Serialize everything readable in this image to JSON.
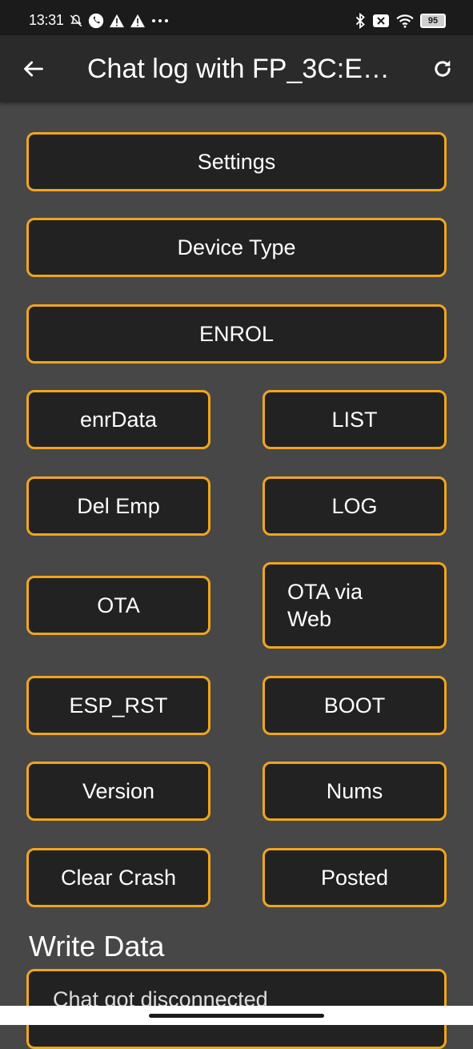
{
  "status_bar": {
    "time": "13:31",
    "battery": "95",
    "left_icons": [
      "mute-icon",
      "phone-icon",
      "warning-icon",
      "warning-icon",
      "more-icon"
    ],
    "right_icons": [
      "bluetooth-icon",
      "mute-box-icon",
      "wifi-icon",
      "battery-icon"
    ]
  },
  "app_bar": {
    "title": "Chat log with FP_3C:E…",
    "back_icon": "arrow-left-icon",
    "refresh_icon": "refresh-icon"
  },
  "buttons": {
    "settings": "Settings",
    "device_type": "Device Type",
    "enrol": "ENROL",
    "enr_data": "enrData",
    "list": "LIST",
    "del_emp": "Del Emp",
    "log": "LOG",
    "ota": "OTA",
    "ota_via_web_line1": "OTA via",
    "ota_via_web_line2": "Web",
    "esp_rst": "ESP_RST",
    "boot": "BOOT",
    "version": "Version",
    "nums": "Nums",
    "clear_crash": "Clear Crash",
    "posted": "Posted"
  },
  "write_section": {
    "title": "Write Data",
    "message": "Chat got disconnected"
  },
  "colors": {
    "accent": "#f0a51d",
    "button_bg": "#222222",
    "page_bg": "#474747",
    "app_bar_bg": "#2a2a2a",
    "status_bg": "#1b1b1b"
  }
}
